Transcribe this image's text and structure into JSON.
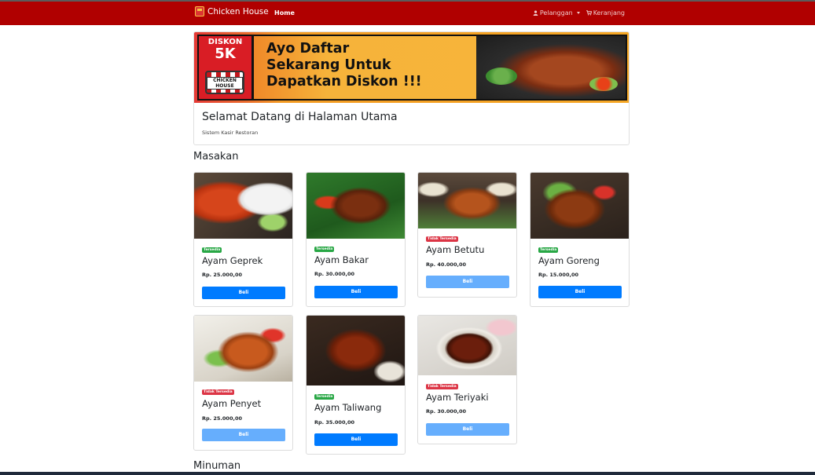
{
  "navbar": {
    "brand": "Chicken House",
    "home": "Home",
    "pelanggan": "Pelanggan",
    "keranjang": "Keranjang",
    "bg_color": "#b00000"
  },
  "hero": {
    "banner": {
      "diskon": "DISKON",
      "amount": "5K",
      "logo_text": "CHICKEN HOUSE",
      "line1": "Ayo Daftar",
      "line2": "Sekarang Untuk",
      "line3": "Dapatkan Diskon !!!"
    },
    "title": "Selamat Datang di Halaman Utama",
    "subtitle": "Sistem Kasir Restoran"
  },
  "sections": {
    "masakan": "Masakan",
    "minuman": "Minuman"
  },
  "products": [
    {
      "badge": "Tersedia",
      "status": "ok",
      "name": "Ayam Geprek",
      "price": "Rp. 25.000,00",
      "button": "Beli"
    },
    {
      "badge": "Tersedia",
      "status": "ok",
      "name": "Ayam Bakar",
      "price": "Rp. 30.000,00",
      "button": "Beli"
    },
    {
      "badge": "Tidak Tersedia",
      "status": "no",
      "name": "Ayam Betutu",
      "price": "Rp. 40.000,00",
      "button": "Beli"
    },
    {
      "badge": "Tersedia",
      "status": "ok",
      "name": "Ayam Goreng",
      "price": "Rp. 15.000,00",
      "button": "Beli"
    },
    {
      "badge": "Tidak Tersedia",
      "status": "no",
      "name": "Ayam Penyet",
      "price": "Rp. 25.000,00",
      "button": "Beli"
    },
    {
      "badge": "Tersedia",
      "status": "ok",
      "name": "Ayam Taliwang",
      "price": "Rp. 35.000,00",
      "button": "Beli"
    },
    {
      "badge": "Tidak Tersedia",
      "status": "no",
      "name": "Ayam Teriyaki",
      "price": "Rp. 30.000,00",
      "button": "Beli"
    }
  ],
  "colors": {
    "available": "#28a745",
    "unavailable": "#dc3545",
    "button": "#007bff",
    "button_disabled": "#66aefd"
  }
}
